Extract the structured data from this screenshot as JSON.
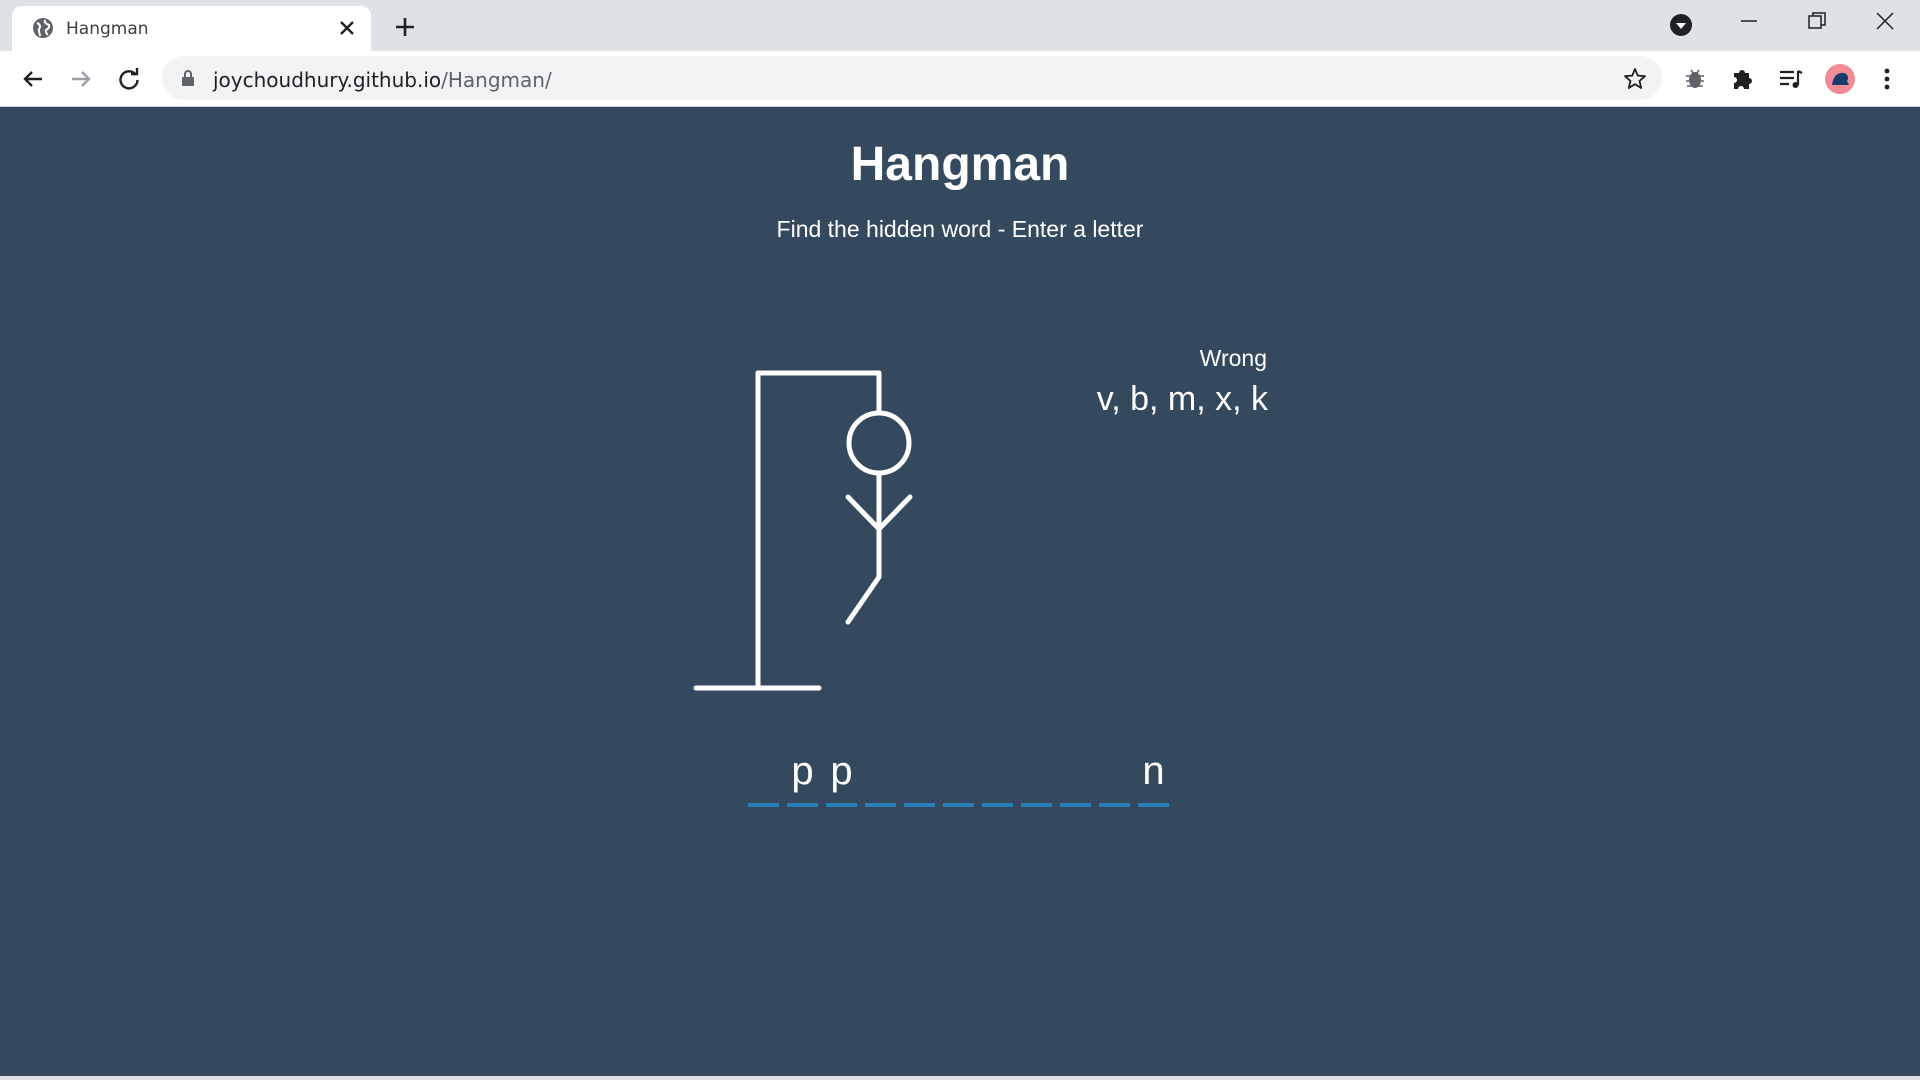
{
  "browser": {
    "tab_title": "Hangman",
    "url_host": "joychoudhury.github.io",
    "url_path": "/Hangman/"
  },
  "page": {
    "title": "Hangman",
    "subtitle": "Find the hidden word - Enter a letter",
    "wrong_label": "Wrong",
    "wrong_letters": "v, b, m, x, k"
  },
  "word_slots": [
    "",
    "p",
    "p",
    "",
    "",
    "",
    "",
    "",
    "",
    "",
    "n"
  ],
  "colors": {
    "background": "#34495e",
    "underline": "#2980b9",
    "figure": "#ffffff"
  },
  "icons": [
    "globe-icon",
    "close-icon",
    "plus-icon",
    "tab-search-icon",
    "minimize-icon",
    "restore-icon",
    "window-close-icon",
    "back-arrow-icon",
    "forward-arrow-icon",
    "reload-icon",
    "lock-icon",
    "star-icon",
    "bug-extension-icon",
    "puzzle-extensions-icon",
    "media-queue-icon",
    "profile-avatar-icon",
    "more-menu-icon"
  ]
}
